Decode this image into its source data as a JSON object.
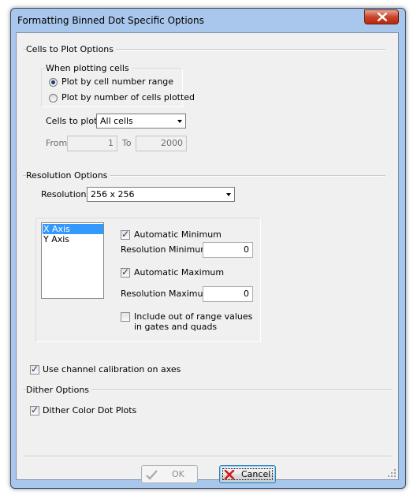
{
  "window": {
    "title": "Formatting Binned Dot Specific Options"
  },
  "cells_to_plot": {
    "group_label": "Cells to Plot Options",
    "when_plotting_label": "When plotting cells",
    "radio_range": "Plot by cell number range",
    "radio_number": "Plot by number of cells plotted",
    "selected_radio": "range",
    "cells_to_plot_label": "Cells to plot",
    "cells_to_plot_value": "All cells",
    "from_label": "From",
    "from_value": "1",
    "to_label": "To",
    "to_value": "2000"
  },
  "resolution": {
    "group_label": "Resolution Options",
    "resolution_label": "Resolution",
    "resolution_value": "256 x 256",
    "axes": [
      "X Axis",
      "Y Axis"
    ],
    "selected_axis": "X Axis",
    "auto_min_label": "Automatic Minimum",
    "auto_min_checked": true,
    "res_min_label": "Resolution Minimum",
    "res_min_value": "0",
    "auto_max_label": "Automatic Maximum",
    "auto_max_checked": true,
    "res_max_label": "Resolution Maximum",
    "res_max_value": "0",
    "include_oor_line1": "Include out of range values",
    "include_oor_line2": "in gates and quads",
    "include_oor_checked": false
  },
  "calibration": {
    "label": "Use channel calibration on axes",
    "checked": true
  },
  "dither": {
    "group_label": "Dither Options",
    "label": "Dither Color Dot Plots",
    "checked": true
  },
  "buttons": {
    "ok": "OK",
    "cancel": "Cancel"
  },
  "colors": {
    "accent_red": "#d11a1a",
    "selection_blue": "#3399ff",
    "ok_green_gray": "#9a9a9a"
  }
}
